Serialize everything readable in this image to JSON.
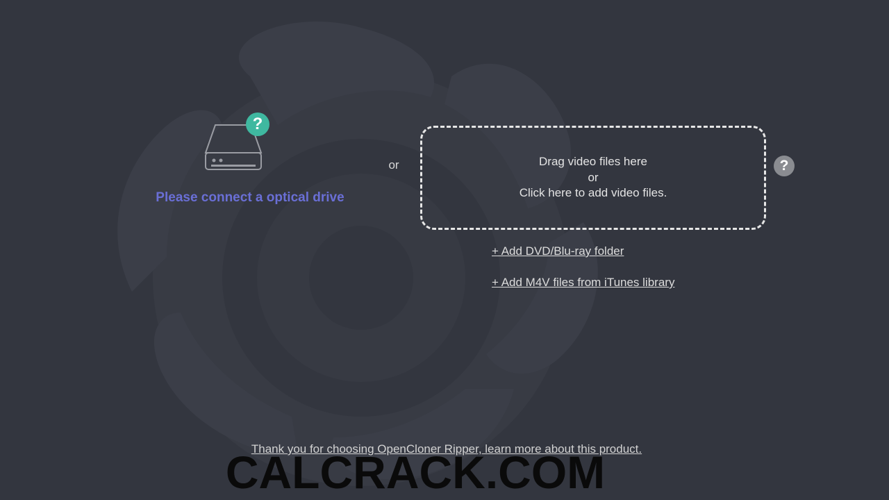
{
  "drive": {
    "label": "Please connect a optical drive",
    "help_icon": "question-circle-icon",
    "drive_icon": "optical-drive-icon"
  },
  "separator": {
    "or": "or"
  },
  "drop_zone": {
    "line1": "Drag video files here",
    "line2": "or",
    "line3": "Click here to add video files."
  },
  "help_icon": "question-circle-icon",
  "links": {
    "add_folder": "+ Add DVD/Blu-ray folder",
    "add_m4v": "+ Add M4V files from iTunes library"
  },
  "footer": {
    "text": "Thank you for choosing OpenCloner Ripper, learn more about this product."
  },
  "watermark": {
    "text": "CALCRACK.COM"
  },
  "colors": {
    "background": "#33363f",
    "drive_label": "#6a6fd6",
    "help_green": "#3fb8a0",
    "help_gray": "#8a8c91",
    "text": "#e4e4e4"
  }
}
